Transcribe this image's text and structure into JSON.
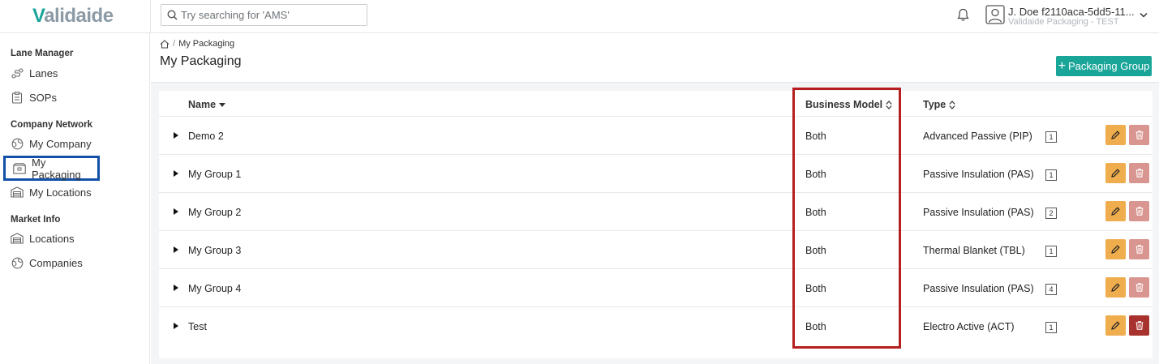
{
  "brand": {
    "logo_v": "V",
    "logo_rest": "alidaide"
  },
  "search": {
    "placeholder": "Try searching for 'AMS'"
  },
  "user": {
    "name": "J. Doe f2110aca-5dd5-11...",
    "org": "Validaide Packaging - TEST"
  },
  "sidebar": {
    "sections": [
      {
        "title": "Lane Manager",
        "items": [
          {
            "label": "Lanes",
            "icon": "lanes-icon"
          },
          {
            "label": "SOPs",
            "icon": "clipboard-icon"
          }
        ]
      },
      {
        "title": "Company Network",
        "items": [
          {
            "label": "My Company",
            "icon": "globe-icon"
          },
          {
            "label": "My Packaging",
            "icon": "packaging-icon",
            "active": true
          },
          {
            "label": "My Locations",
            "icon": "warehouse-icon"
          }
        ]
      },
      {
        "title": "Market Info",
        "items": [
          {
            "label": "Locations",
            "icon": "warehouse-icon"
          },
          {
            "label": "Companies",
            "icon": "globe-icon"
          }
        ]
      }
    ]
  },
  "breadcrumb": {
    "sep": "/",
    "current": "My Packaging"
  },
  "page": {
    "title": "My Packaging",
    "add_button": "Packaging Group",
    "add_plus": "+"
  },
  "table": {
    "columns": {
      "name": "Name",
      "business_model": "Business Model",
      "type": "Type"
    },
    "rows": [
      {
        "name": "Demo 2",
        "business_model": "Both",
        "type": "Advanced Passive (PIP)",
        "count": "1"
      },
      {
        "name": "My Group 1",
        "business_model": "Both",
        "type": "Passive Insulation (PAS)",
        "count": "1"
      },
      {
        "name": "My Group 2",
        "business_model": "Both",
        "type": "Passive Insulation (PAS)",
        "count": "2"
      },
      {
        "name": "My Group 3",
        "business_model": "Both",
        "type": "Thermal Blanket (TBL)",
        "count": "1"
      },
      {
        "name": "My Group 4",
        "business_model": "Both",
        "type": "Passive Insulation (PAS)",
        "count": "4"
      },
      {
        "name": "Test",
        "business_model": "Both",
        "type": "Electro Active (ACT)",
        "count": "1"
      }
    ]
  },
  "colors": {
    "accent": "#1aa599",
    "edit": "#f0ad4e",
    "delete_disabled": "#d9958f",
    "delete_enabled": "#a8332e",
    "highlight_red": "#b51f1f",
    "highlight_blue": "#1350a8"
  }
}
